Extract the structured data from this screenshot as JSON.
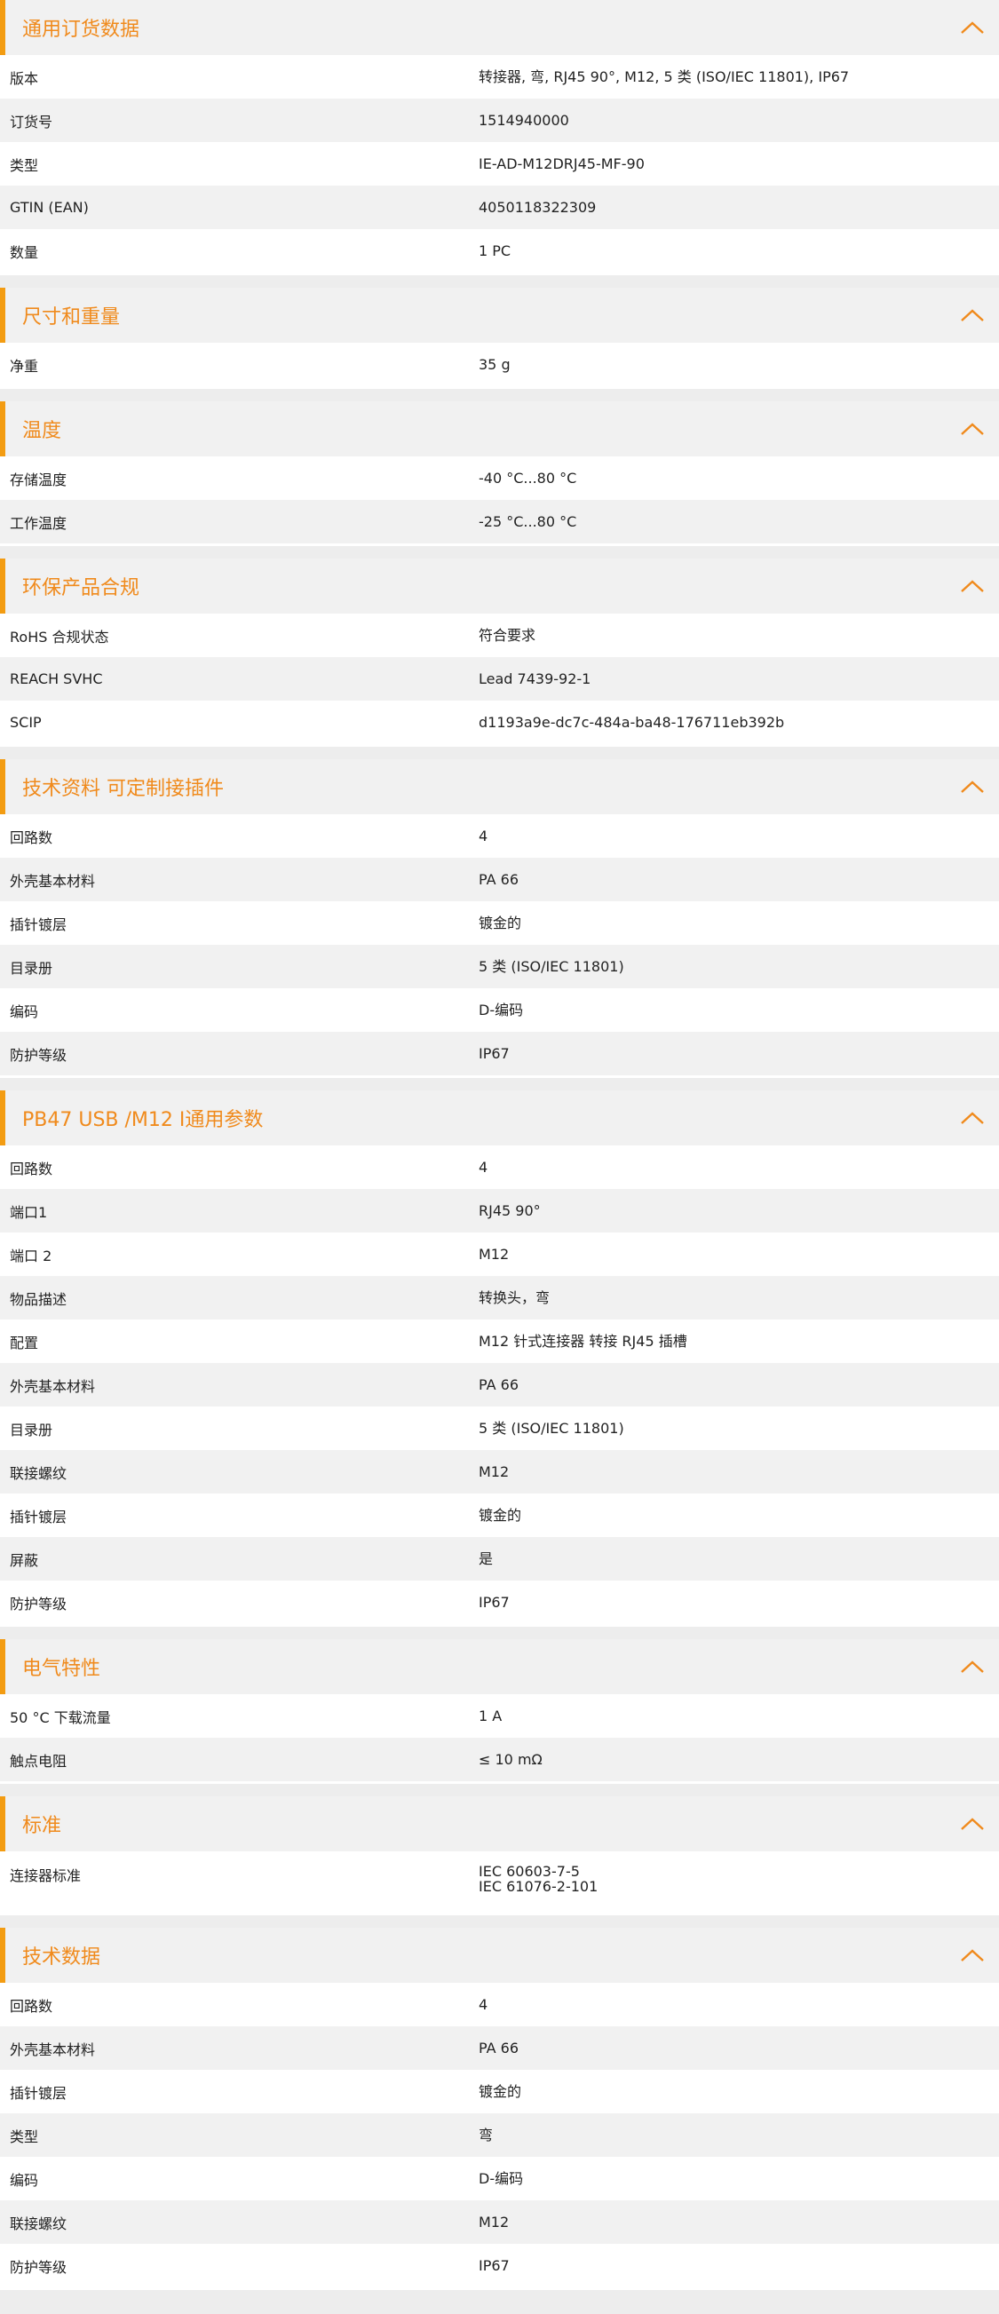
{
  "accent_color": "#f08a1c",
  "collapse_icon": "chevron-up-icon",
  "sections": [
    {
      "title": "通用订货数据",
      "rows": [
        {
          "label": "版本",
          "value": "转接器, 弯, RJ45 90°, M12, 5 类 (ISO/IEC 11801), IP67"
        },
        {
          "label": "订货号",
          "value": "1514940000"
        },
        {
          "label": "类型",
          "value": "IE-AD-M12DRJ45-MF-90"
        },
        {
          "label": "GTIN (EAN)",
          "value": "4050118322309"
        },
        {
          "label": "数量",
          "value": "1  PC"
        }
      ]
    },
    {
      "title": "尺寸和重量",
      "rows": [
        {
          "label": "净重",
          "value": "35  g"
        }
      ]
    },
    {
      "title": "温度",
      "rows": [
        {
          "label": "存储温度",
          "value": "-40 °C...80 °C"
        },
        {
          "label": "工作温度",
          "value": "-25 °C...80 °C"
        }
      ]
    },
    {
      "title": "环保产品合规",
      "rows": [
        {
          "label": "RoHS 合规状态",
          "value": "符合要求"
        },
        {
          "label": "REACH SVHC",
          "value": "Lead 7439-92-1"
        },
        {
          "label": "SCIP",
          "value": "d1193a9e-dc7c-484a-ba48-176711eb392b"
        }
      ]
    },
    {
      "title": "技术资料 可定制接插件",
      "rows": [
        {
          "label": "回路数",
          "value": "4"
        },
        {
          "label": "外壳基本材料",
          "value": "PA 66"
        },
        {
          "label": "插针镀层",
          "value": "镀金的"
        },
        {
          "label": "目录册",
          "value": "5 类 (ISO/IEC 11801)"
        },
        {
          "label": "编码",
          "value": "D-编码"
        },
        {
          "label": "防护等级",
          "value": "IP67"
        }
      ]
    },
    {
      "title": "PB47 USB /M12 I通用参数",
      "rows": [
        {
          "label": "回路数",
          "value": "4"
        },
        {
          "label": "端口1",
          "value": "RJ45 90°"
        },
        {
          "label": "端口 2",
          "value": "M12"
        },
        {
          "label": "物品描述",
          "value": "转换头，弯"
        },
        {
          "label": "配置",
          "value": "M12 针式连接器 转接 RJ45 插槽"
        },
        {
          "label": "外壳基本材料",
          "value": "PA 66"
        },
        {
          "label": "目录册",
          "value": "5 类 (ISO/IEC 11801)"
        },
        {
          "label": "联接螺纹",
          "value": "M12"
        },
        {
          "label": "插针镀层",
          "value": "镀金的"
        },
        {
          "label": "屏蔽",
          "value": "是"
        },
        {
          "label": "防护等级",
          "value": "IP67"
        }
      ]
    },
    {
      "title": "电气特性",
      "rows": [
        {
          "label": "50 °C 下载流量",
          "value": "1  A"
        },
        {
          "label": "触点电阻",
          "value": "≤ 10 mΩ"
        }
      ]
    },
    {
      "title": "标准",
      "rows": [
        {
          "label": "连接器标准",
          "value": "IEC 60603-7-5",
          "value2": "IEC 61076-2-101"
        }
      ]
    },
    {
      "title": "技术数据",
      "rows": [
        {
          "label": "回路数",
          "value": "4"
        },
        {
          "label": "外壳基本材料",
          "value": "PA 66"
        },
        {
          "label": "插针镀层",
          "value": "镀金的"
        },
        {
          "label": "类型",
          "value": "弯"
        },
        {
          "label": "编码",
          "value": "D-编码"
        },
        {
          "label": "联接螺纹",
          "value": "M12"
        },
        {
          "label": "防护等级",
          "value": "IP67"
        }
      ]
    }
  ]
}
